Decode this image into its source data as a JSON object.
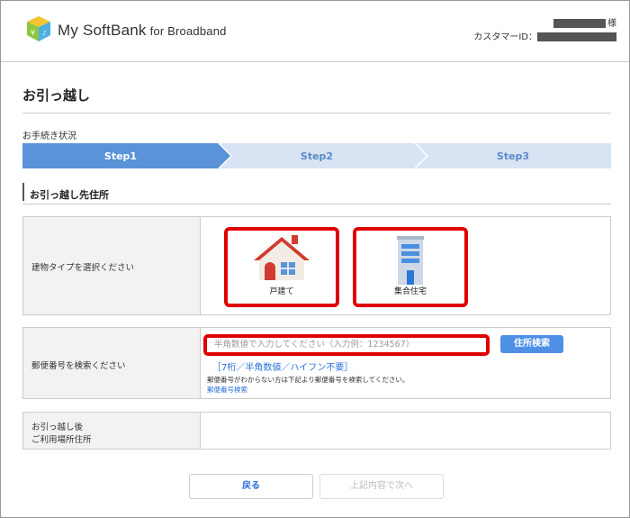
{
  "header": {
    "brand": "My SoftBank",
    "brand_suffix": "for Broadband",
    "honorific": "様",
    "customer_id_label": "カスタマーID："
  },
  "page": {
    "title": "お引っ越し",
    "progress_label": "お手続き状況"
  },
  "steps": [
    {
      "label": "Step1",
      "active": true
    },
    {
      "label": "Step2",
      "active": false
    },
    {
      "label": "Step3",
      "active": false
    }
  ],
  "section": {
    "title": "お引っ越し先住所"
  },
  "building": {
    "label": "建物タイプを選択ください",
    "options": [
      {
        "label": "戸建て",
        "icon": "house-icon"
      },
      {
        "label": "集合住宅",
        "icon": "apartment-icon"
      }
    ]
  },
  "postal": {
    "label": "郵便番号を検索ください",
    "placeholder": "半角数値で入力してください（入力例：1234567）",
    "search_button": "住所検索",
    "hint": "［7桁／半角数値／ハイフン不要］",
    "note": "郵便番号がわからない方は下記より郵便番号を検索してください。",
    "link": "郵便番号検索"
  },
  "address": {
    "label_line1": "お引っ越し後",
    "label_line2": "ご利用場所住所"
  },
  "buttons": {
    "back": "戻る",
    "next": "上記内容で次へ"
  },
  "colors": {
    "step_active": "#5b93d8",
    "step_inactive": "#d8e4f3",
    "highlight_red": "#e00000",
    "button_blue": "#4f8fe6",
    "link_blue": "#2a6fd8"
  }
}
